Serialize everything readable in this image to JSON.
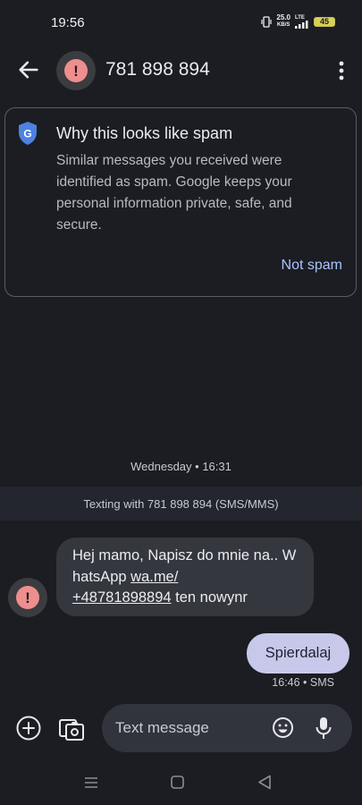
{
  "status_bar": {
    "time": "19:56",
    "net_speed_value": "25.0",
    "net_speed_unit": "KB/S",
    "network_type": "LTE",
    "battery": "45"
  },
  "header": {
    "title": "781 898 894",
    "back_icon": "arrow-left-icon",
    "avatar_icon": "warning-icon",
    "menu_icon": "more-vert-icon"
  },
  "spam_card": {
    "icon": "google-shield-icon",
    "title": "Why this looks like spam",
    "body": "Similar messages you received were identified as spam. Google keeps your personal information private, safe, and secure.",
    "action_label": "Not spam"
  },
  "conversation": {
    "date_label": "Wednesday • 16:31",
    "info_bar": "Texting with 781 898 894 (SMS/MMS)",
    "incoming": {
      "text_part1": "Hej mamo, Napisz do mnie na.. W hatsApp ",
      "link_part1": "wa.me/",
      "link_part2": "+48781898894",
      "text_part2": " ten nowynr"
    },
    "outgoing": {
      "text": "Spierdalaj",
      "meta": "16:46 • SMS"
    }
  },
  "compose": {
    "placeholder": "Text message",
    "add_icon": "add-circle-icon",
    "media_icon": "gallery-icon",
    "emoji_icon": "emoji-icon",
    "mic_icon": "mic-icon"
  },
  "nav_bar": {
    "menu_icon": "recent-apps-icon",
    "home_icon": "home-icon",
    "back_icon": "back-triangle-icon"
  },
  "colors": {
    "background": "#1b1d23",
    "spam_warning": "#ee8e8e",
    "link_accent": "#a9c4ff",
    "outgoing_bubble": "#c8c9ea",
    "incoming_bubble": "#35373f"
  }
}
